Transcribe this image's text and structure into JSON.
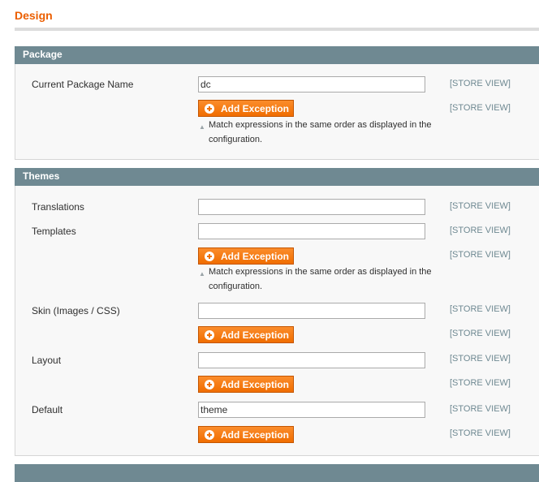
{
  "page": {
    "title": "Design"
  },
  "scope_label": "[STORE VIEW]",
  "add_exception_label": "Add Exception",
  "note_text": "Match expressions in the same order as displayed in the configuration.",
  "sections": {
    "package": {
      "title": "Package",
      "fields": {
        "current_package_name": {
          "label": "Current Package Name",
          "value": "dc"
        }
      }
    },
    "themes": {
      "title": "Themes",
      "fields": {
        "translations": {
          "label": "Translations",
          "value": ""
        },
        "templates": {
          "label": "Templates",
          "value": ""
        },
        "skin": {
          "label": "Skin (Images / CSS)",
          "value": ""
        },
        "layout": {
          "label": "Layout",
          "value": ""
        },
        "default": {
          "label": "Default",
          "value": "theme"
        }
      }
    }
  },
  "colors": {
    "accent": "#eb5e00",
    "section_header": "#6f8992",
    "button": "#f47b10"
  }
}
